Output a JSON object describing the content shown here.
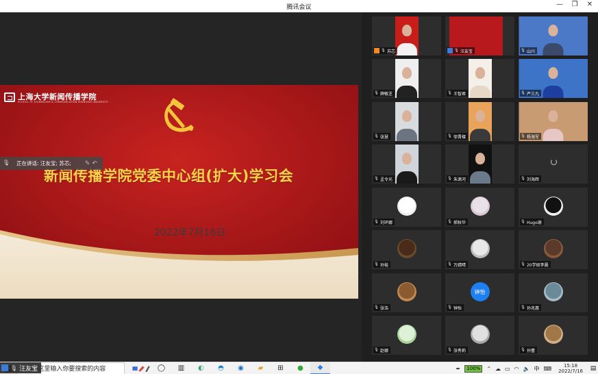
{
  "window": {
    "title": "腾讯会议"
  },
  "slide": {
    "school_name": "上海大学新闻传播学院",
    "school_name_en": "SCHOOL OF JOURNALISM & COMMUNICATION SHANGHAI UNIVERSITY",
    "headline": "新闻传播学院党委中心组(扩大)学习会",
    "date": "2022年7月16日"
  },
  "speaking": {
    "label": "正在讲话: 汪友宝; 苏芯;"
  },
  "self_tag": {
    "name": "汪友宝"
  },
  "participants": [
    {
      "name": "苏芯",
      "host": "orange"
    },
    {
      "name": "汪友宝",
      "host": "blue"
    },
    {
      "name": "山川"
    },
    {
      "name": "薛敏芝"
    },
    {
      "name": "王智君"
    },
    {
      "name": "严三九"
    },
    {
      "name": "张慧"
    },
    {
      "name": "邬晋樑"
    },
    {
      "name": "杨海军"
    },
    {
      "name": "孟令光"
    },
    {
      "name": "朱滴河"
    },
    {
      "name": "刘海辉"
    },
    {
      "name": "刘环娜"
    },
    {
      "name": "郝秋华"
    },
    {
      "name": "Hugo谢"
    },
    {
      "name": "孙裕"
    },
    {
      "name": "万婧晴"
    },
    {
      "name": "20学硕李晨"
    },
    {
      "name": "张浩"
    },
    {
      "name": "钟怡",
      "avatar_text": "钟怡"
    },
    {
      "name": "孙兆惠"
    },
    {
      "name": "赵娜"
    },
    {
      "name": "张秀莉"
    },
    {
      "name": "孙蕾"
    }
  ],
  "taskbar": {
    "search_placeholder": "在这里输入你要搜索的内容",
    "battery": "100%",
    "ime": "中",
    "time": "15:18",
    "date": "2022/7/16"
  },
  "colors": {
    "slide_red": "#b8191d",
    "headline_gold": "#f7d44a",
    "accent_blue": "#3d7bd9"
  }
}
